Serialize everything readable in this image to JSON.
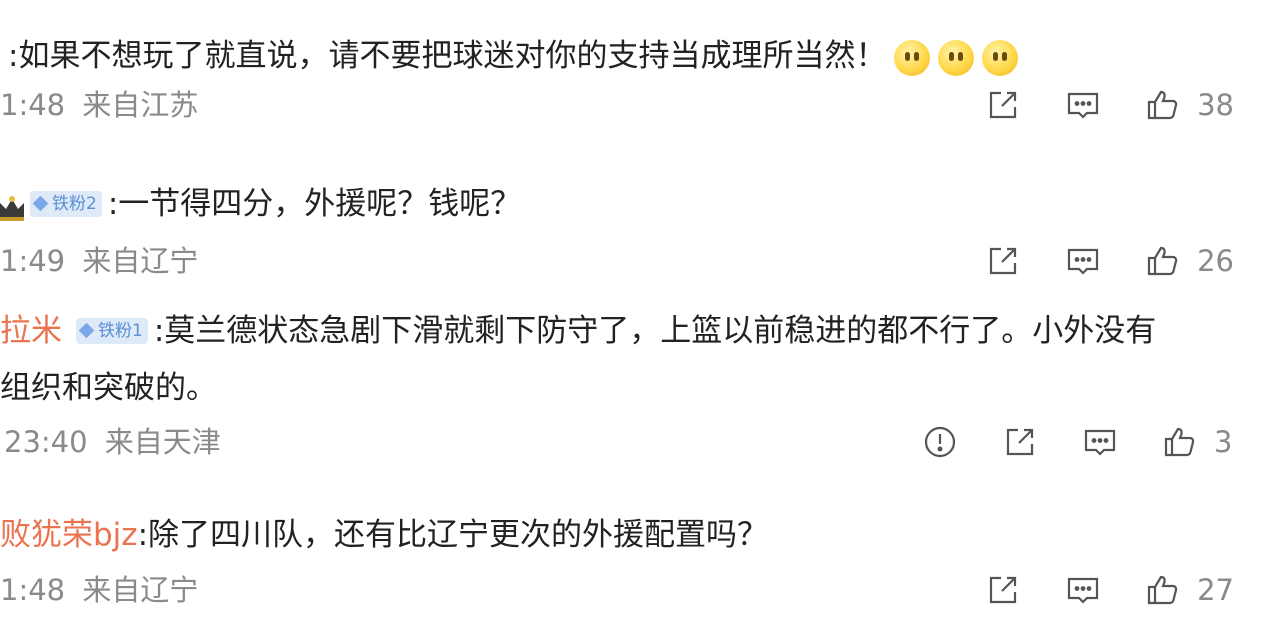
{
  "comments": [
    {
      "username": "",
      "prefix_fragment": "",
      "text": ":如果不想玩了就直说，请不要把球迷对你的支持当成理所当然！",
      "emojis": [
        "slightly-smiling-emoji",
        "slightly-smiling-emoji",
        "slightly-smiling-emoji"
      ],
      "time": "1:48",
      "location": "来自江苏",
      "likes": "38"
    },
    {
      "username": "",
      "badge": "铁粉2",
      "text": ":一节得四分，外援呢？钱呢？",
      "time": "1:49",
      "location": "来自辽宁",
      "likes": "26"
    },
    {
      "username": "拉米",
      "badge": "铁粉1",
      "text": ":莫兰德状态急剧下滑就剩下防守了，上篮以前稳进的都不行了。小外没有",
      "text_line2": "组织和突破的。",
      "time": "23:40",
      "location": "来自天津",
      "likes": "3"
    },
    {
      "username": "败犹荣bjz",
      "text": ":除了四川队，还有比辽宁更次的外援配置吗？",
      "time": "1:48",
      "location": "来自辽宁",
      "likes": "27"
    }
  ],
  "icons": {
    "share": "share-icon",
    "comment": "comment-icon",
    "like": "thumbs-up-icon",
    "report": "report-icon"
  },
  "colors": {
    "username": "#eb7350",
    "meta": "#8a8a8a",
    "badge_bg": "#dfeaf9",
    "badge_text": "#5b8fd6"
  }
}
